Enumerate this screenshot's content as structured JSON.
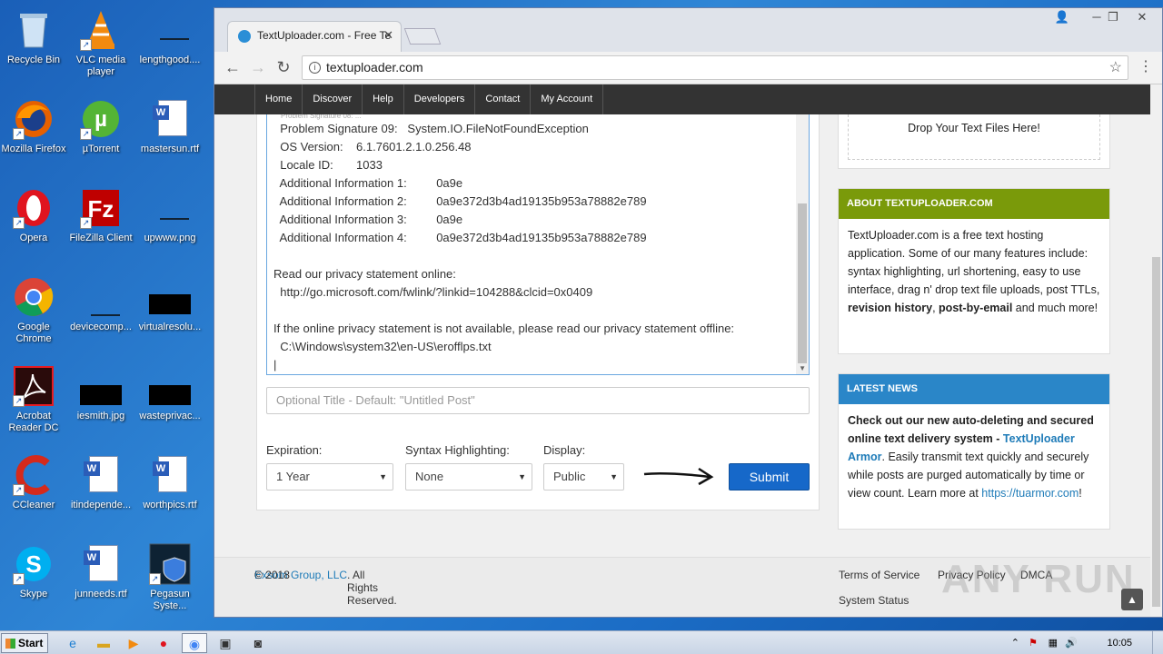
{
  "desktop": {
    "icons": [
      {
        "label": "Recycle Bin"
      },
      {
        "label": "VLC media player"
      },
      {
        "label": "lengthgood...."
      },
      {
        "label": "Mozilla Firefox"
      },
      {
        "label": "µTorrent"
      },
      {
        "label": "mastersun.rtf"
      },
      {
        "label": "Opera"
      },
      {
        "label": "FileZilla Client"
      },
      {
        "label": "upwww.png"
      },
      {
        "label": "Google Chrome"
      },
      {
        "label": "devicecomp..."
      },
      {
        "label": "virtualresolu..."
      },
      {
        "label": "Acrobat Reader DC"
      },
      {
        "label": "iesmith.jpg"
      },
      {
        "label": "wasteprivac..."
      },
      {
        "label": "CCleaner"
      },
      {
        "label": "itindepende..."
      },
      {
        "label": "worthpics.rtf"
      },
      {
        "label": "Skype"
      },
      {
        "label": "junneeds.rtf"
      },
      {
        "label": "Pegasun Syste..."
      }
    ]
  },
  "browser": {
    "tab_title": "TextUploader.com - Free Te",
    "url": "textuploader.com",
    "nav": [
      "Home",
      "Discover",
      "Help",
      "Developers",
      "Contact",
      "My Account"
    ]
  },
  "editor": {
    "lines": [
      "  Problem Signature 09:   System.IO.FileNotFoundException",
      "  OS Version:    6.1.7601.2.1.0.256.48",
      "  Locale ID:       1033",
      "  Additional Information 1:         0a9e",
      "  Additional Information 2:         0a9e372d3b4ad19135b953a78882e789",
      "  Additional Information 3:         0a9e",
      "  Additional Information 4:         0a9e372d3b4ad19135b953a78882e789",
      "",
      "Read our privacy statement online:",
      "  http://go.microsoft.com/fwlink/?linkid=104288&clcid=0x0409",
      "",
      "If the online privacy statement is not available, please read our privacy statement offline:",
      "  C:\\Windows\\system32\\en-US\\erofflps.txt",
      "|"
    ],
    "title_placeholder": "Optional Title - Default: \"Untitled Post\"",
    "expiration_label": "Expiration:",
    "expiration_value": "1 Year",
    "syntax_label": "Syntax Highlighting:",
    "syntax_value": "None",
    "display_label": "Display:",
    "display_value": "Public",
    "submit_label": "Submit"
  },
  "sidebar": {
    "drop_text": "Drop Your Text Files Here!",
    "about_title": "ABOUT TEXTUPLOADER.COM",
    "about_color": "#7a9a0a",
    "about_text_1": "TextUploader.com is a free text hosting application. Some of our many features include: syntax highlighting, url shortening, easy to use interface, drag n' drop text file uploads, post TTLs, ",
    "about_bold_1": "revision history",
    "about_sep": ", ",
    "about_bold_2": "post-by-email",
    "about_text_2": " and much more!",
    "news_title": "LATEST NEWS",
    "news_color": "#2a86c8",
    "news_bold": "Check out our new auto-deleting and secured online text delivery system - ",
    "news_link": "TextUploader Armor",
    "news_text": ". Easily transmit text quickly and securely while posts are purged automatically by time or view count. Learn more at ",
    "news_url": "https://tuarmor.com",
    "news_end": "!"
  },
  "footer": {
    "copyright_prefix": "© 2018 ",
    "company": "Exsom Group, LLC",
    "copyright_suffix": ". All Rights Reserved.",
    "links": [
      "Terms of Service",
      "Privacy Policy",
      "DMCA",
      "System Status"
    ]
  },
  "watermark": "ANY RUN",
  "taskbar": {
    "start_label": "Start",
    "clock": "10:05 AM"
  }
}
